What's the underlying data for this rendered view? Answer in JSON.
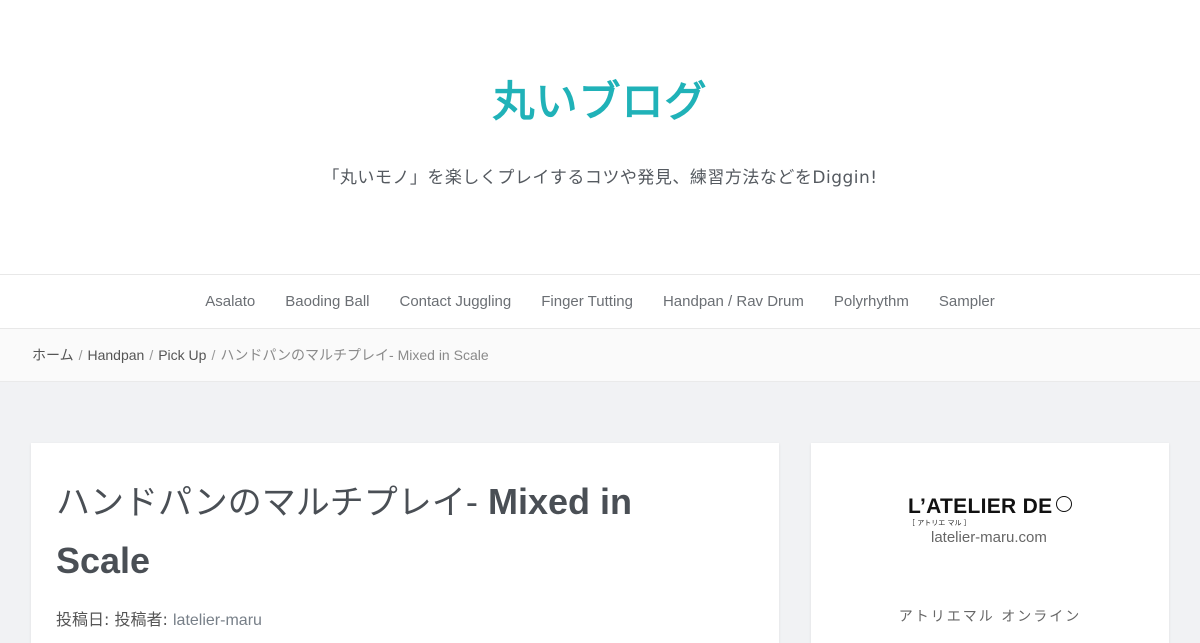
{
  "header": {
    "site_title": "丸いブログ",
    "site_description": "「丸いモノ」を楽しくプレイするコツや発見、練習方法などをDiggin!"
  },
  "nav": {
    "items": [
      {
        "label": "Asalato"
      },
      {
        "label": "Baoding Ball"
      },
      {
        "label": "Contact Juggling"
      },
      {
        "label": "Finger Tutting"
      },
      {
        "label": "Handpan / Rav Drum"
      },
      {
        "label": "Polyrhythm"
      },
      {
        "label": "Sampler"
      }
    ]
  },
  "breadcrumb": {
    "items": [
      "ホーム",
      "Handpan",
      "Pick Up"
    ],
    "separator": "/",
    "current": "ハンドパンのマルチプレイ- Mixed in Scale"
  },
  "article": {
    "title_jp": "ハンドパンのマルチプレイ-",
    "title_latin_1": " Mixed in",
    "title_latin_2": "Scale",
    "posted_on_label": "投稿日:",
    "posted_by_label": "投稿者:",
    "author": "latelier-maru"
  },
  "sidebar": {
    "logo_text": "L’ATELIER DE",
    "logo_subtext": "［ アトリエ マル ］",
    "logo_url": "latelier-maru.com",
    "caption": "アトリエマル オンライン"
  },
  "colors": {
    "accent": "#20b2b8",
    "background": "#f1f2f4"
  }
}
